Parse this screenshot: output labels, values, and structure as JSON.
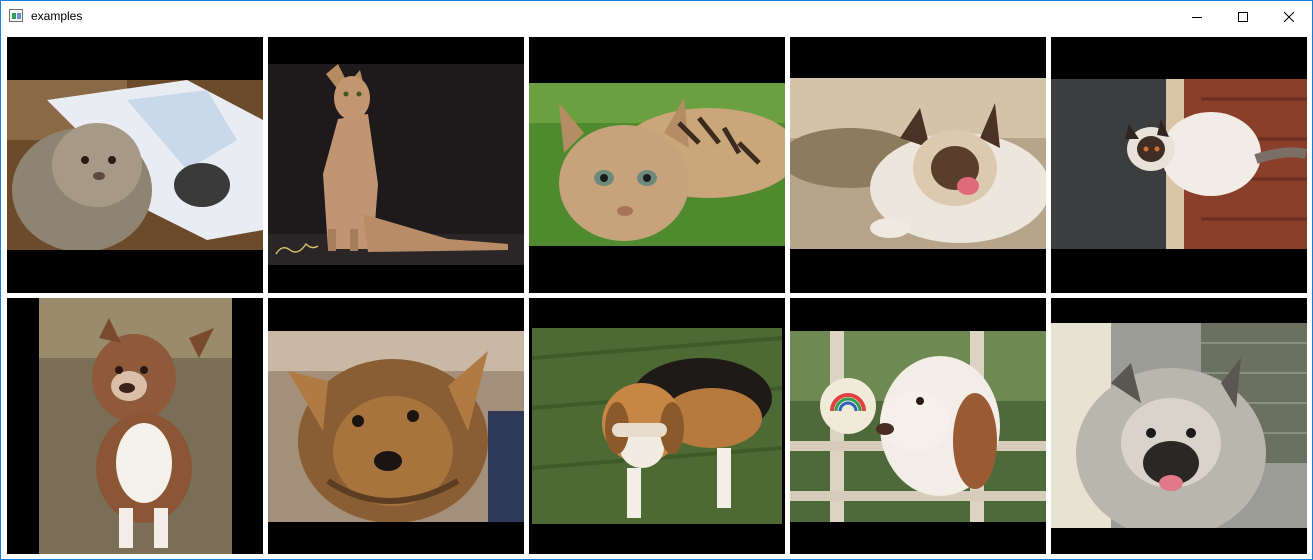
{
  "window": {
    "title": "examples",
    "app_icon": "window-app-icon",
    "controls": [
      "minimize-icon",
      "maximize-icon",
      "close-icon"
    ],
    "accent_border_color": "#1a7ed8"
  },
  "gallery": {
    "tile_background": "#000000",
    "photos": [
      {
        "subject": "persian-cat-on-box"
      },
      {
        "subject": "abyssinian-cat-sitting",
        "watermark": "Chanan"
      },
      {
        "subject": "bengal-cat-in-grass"
      },
      {
        "subject": "birman-cat-yawning"
      },
      {
        "subject": "siamese-cat-on-floor"
      },
      {
        "subject": "pit-bull-sitting"
      },
      {
        "subject": "yorkshire-terrier-face"
      },
      {
        "subject": "beagle-with-bone"
      },
      {
        "subject": "english-setter-by-thermometer"
      },
      {
        "subject": "keeshond-at-door"
      }
    ]
  }
}
